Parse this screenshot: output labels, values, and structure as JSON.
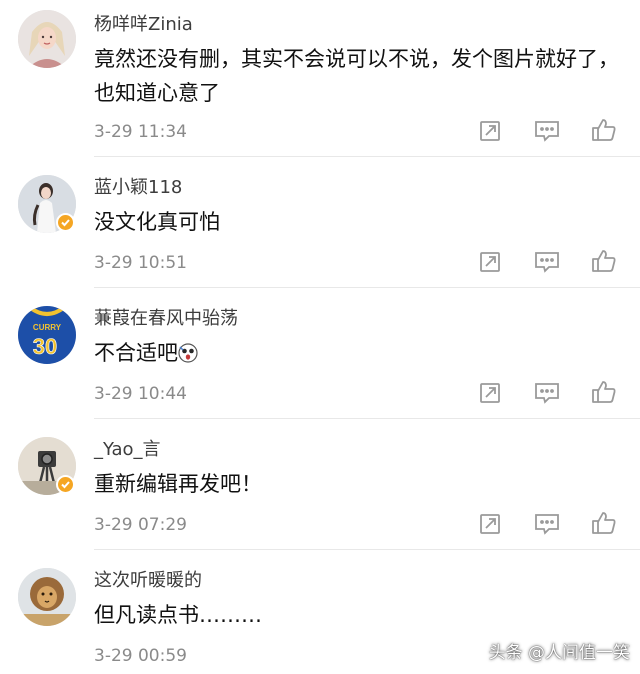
{
  "comments": [
    {
      "author": "杨咩咩Zinia",
      "content": "竟然还没有删，其实不会说可以不说，发个图片就好了，也知道心意了",
      "time": "3-29 11:34",
      "verified": false
    },
    {
      "author": "蓝小颖118",
      "content": "没文化真可怕",
      "time": "3-29 10:51",
      "verified": true
    },
    {
      "author": "蒹葭在春风中骀荡",
      "content": "不合适吧",
      "time": "3-29 10:44",
      "verified": false,
      "jersey_text": "CURRY",
      "jersey_number": "30"
    },
    {
      "author": "_Yao_言",
      "content": "重新编辑再发吧！",
      "time": "3-29 07:29",
      "verified": true
    },
    {
      "author": "这次听暖暖的",
      "content": "但凡读点书………",
      "time": "3-29 00:59",
      "verified": false
    }
  ],
  "actions": {
    "share_icon": "share-icon",
    "reply_icon": "comment-icon",
    "like_icon": "thumbs-up-icon"
  },
  "colors": {
    "badge": "#f5a623",
    "icon": "#9a9a9a",
    "divider": "#e8e8e8"
  },
  "watermark": "头条 @人间值一笑"
}
